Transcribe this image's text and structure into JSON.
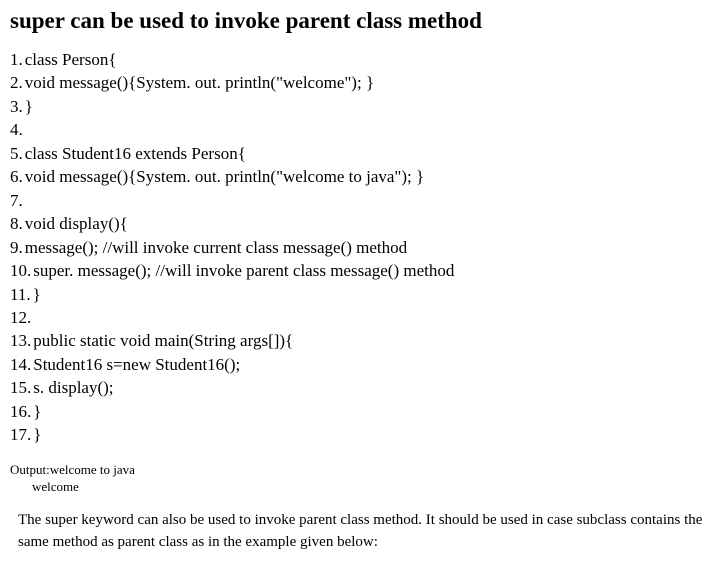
{
  "title": "super can be used to invoke parent class method",
  "code_lines": [
    "class Person{",
    "void message(){System. out. println(\"welcome\"); }",
    "}",
    "",
    "class Student16 extends Person{",
    "void message(){System. out. println(\"welcome to java\"); }",
    "",
    "void display(){",
    "message(); //will invoke current class message() method",
    "super. message(); //will invoke parent class message() method",
    "}",
    "",
    "public static void main(String args[]){",
    "Student16 s=new Student16();",
    "s. display();",
    "}",
    "}"
  ],
  "output": {
    "label": "Output:",
    "line1": "welcome to java",
    "line2": "welcome"
  },
  "description": "The super keyword can also be used to invoke parent class method. It should be used in case subclass contains the same method as parent class as in the example given below:"
}
